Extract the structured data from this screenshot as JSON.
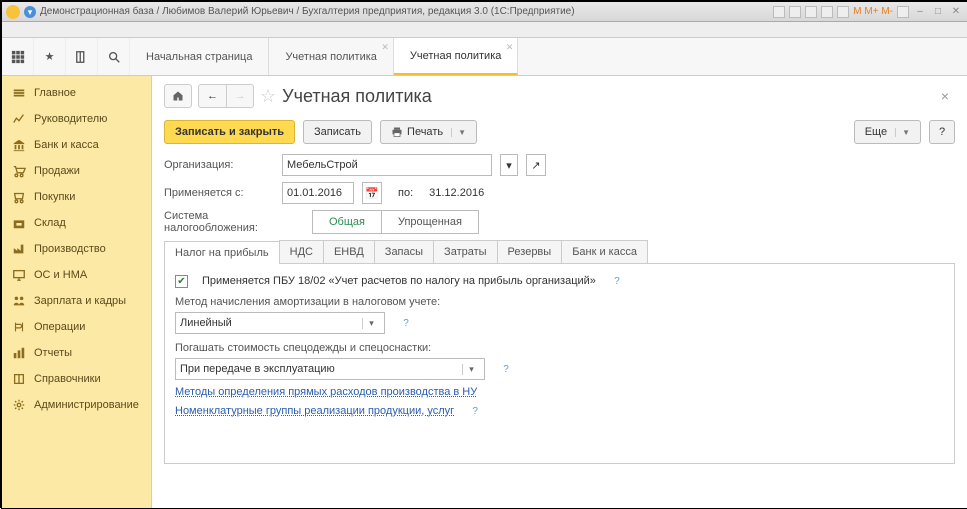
{
  "title": "Демонстрационная база / Любимов Валерий Юрьевич / Бухгалтерия предприятия, редакция 3.0  (1С:Предприятие)",
  "top_tabs": [
    "Начальная страница",
    "Учетная политика",
    "Учетная политика"
  ],
  "sidebar": {
    "items": [
      {
        "label": "Главное",
        "icon": "home"
      },
      {
        "label": "Руководителю",
        "icon": "trend"
      },
      {
        "label": "Банк и касса",
        "icon": "bank"
      },
      {
        "label": "Продажи",
        "icon": "cart"
      },
      {
        "label": "Покупки",
        "icon": "basket"
      },
      {
        "label": "Склад",
        "icon": "box"
      },
      {
        "label": "Производство",
        "icon": "factory"
      },
      {
        "label": "ОС и НМА",
        "icon": "asset"
      },
      {
        "label": "Зарплата и кадры",
        "icon": "people"
      },
      {
        "label": "Операции",
        "icon": "ops"
      },
      {
        "label": "Отчеты",
        "icon": "report"
      },
      {
        "label": "Справочники",
        "icon": "book"
      },
      {
        "label": "Администрирование",
        "icon": "gear"
      }
    ]
  },
  "page": {
    "title": "Учетная политика"
  },
  "cmd": {
    "save_close": "Записать и закрыть",
    "save": "Записать",
    "print": "Печать",
    "more": "Еще"
  },
  "form": {
    "org_label": "Организация:",
    "org_value": "МебельСтрой",
    "applies_label": "Применяется с:",
    "date_from": "01.01.2016",
    "to_label": "по:",
    "date_to": "31.12.2016",
    "tax_system_label": "Система налогообложения:",
    "general": "Общая",
    "simplified": "Упрощенная"
  },
  "inner_tabs": [
    "Налог на прибыль",
    "НДС",
    "ЕНВД",
    "Запасы",
    "Затраты",
    "Резервы",
    "Банк и касса"
  ],
  "panel": {
    "pbu_text": "Применяется ПБУ 18/02 «Учет расчетов по налогу на прибыль организаций»",
    "amort_label": "Метод начисления амортизации в налоговом учете:",
    "amort_value": "Линейный",
    "sp_label": "Погашать стоимость спецодежды и спецоснастки:",
    "sp_value": "При передаче в эксплуатацию",
    "link1": "Методы определения прямых расходов производства в НУ",
    "link2": "Номенклатурные группы реализации продукции, услуг"
  },
  "win_menu": "M  M+  M-"
}
